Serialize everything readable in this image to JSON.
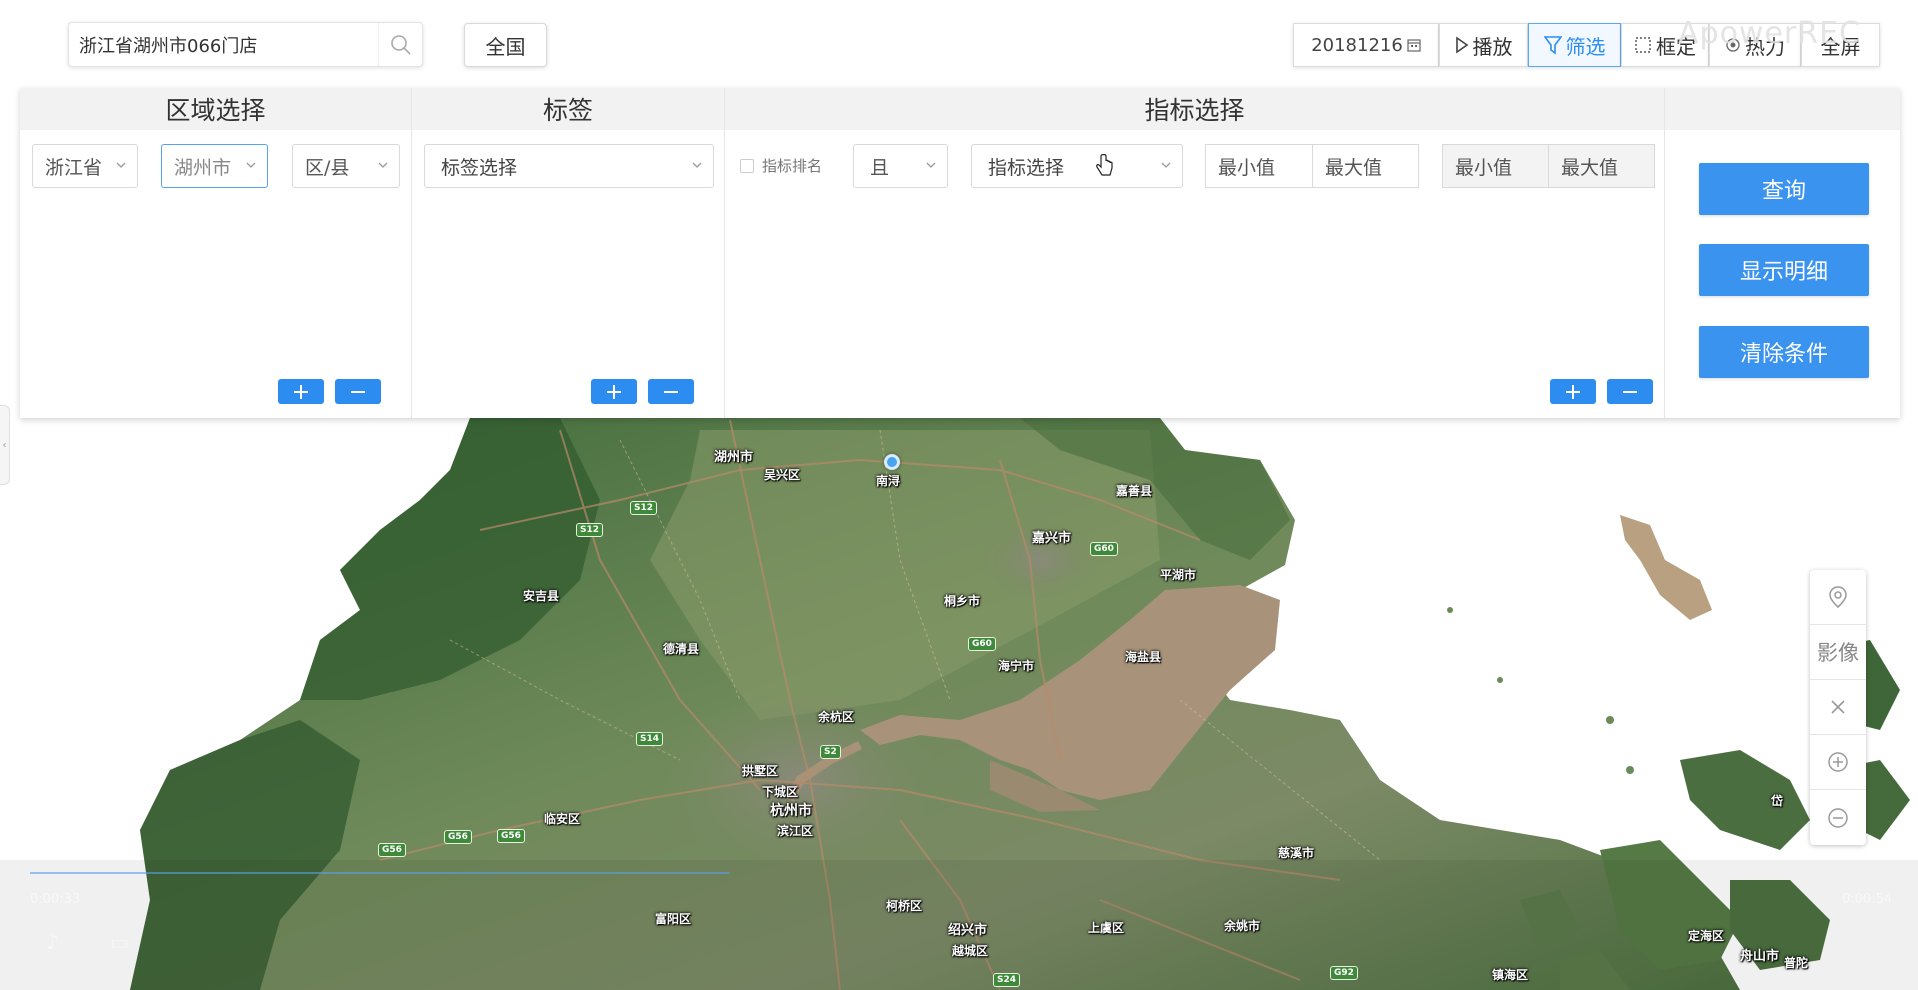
{
  "search": {
    "value": "浙江省湖州市066门店",
    "placeholder": ""
  },
  "nation_button": "全国",
  "toolbar": {
    "date": "20181216",
    "play": "播放",
    "filter": "筛选",
    "box_select": "框定",
    "heat": "热力",
    "fullscreen": "全屏"
  },
  "watermark": "ApowerREC",
  "panel": {
    "region": {
      "title": "区域选择",
      "province": "浙江省",
      "city": "湖州市",
      "district": "区/县"
    },
    "tags": {
      "title": "标签",
      "select": "标签选择"
    },
    "metrics": {
      "title": "指标选择",
      "rank_checkbox": "指标排名",
      "logic": "且",
      "metric_select": "指标选择",
      "min1": "最小值",
      "max1": "最大值",
      "min2": "最小值",
      "max2": "最大值"
    },
    "actions": {
      "query": "查询",
      "show_detail": "显示明细",
      "clear": "清除条件"
    }
  },
  "map_controls": {
    "imagery": "影像"
  },
  "map_labels": {
    "huzhou": "湖州市",
    "wuxing": "吴兴区",
    "nanxun": "南浔",
    "jiashan": "嘉善县",
    "jiaxing": "嘉兴市",
    "pinghu": "平湖市",
    "tongxiang": "桐乡市",
    "anji": "安吉县",
    "deqing": "德清县",
    "haining": "海宁市",
    "haiyan": "海盐县",
    "yuhang": "余杭区",
    "gongshu": "拱墅区",
    "xiacheng": "下城区",
    "hangzhou": "杭州市",
    "binjiang": "滨江区",
    "linan": "临安区",
    "fuyang": "富阳区",
    "keqiao": "柯桥区",
    "shaoxing": "绍兴市",
    "yuecheng": "越城区",
    "shangyu": "上虞区",
    "yuyao": "余姚市",
    "cixi": "慈溪市",
    "zhenhai": "镇海区",
    "dinghai": "定海区",
    "zhoushan": "舟山市",
    "putuo": "普陀",
    "dai": "岱"
  },
  "highway_badges": [
    "S12",
    "S12",
    "G60",
    "G60",
    "S14",
    "S2",
    "G56",
    "G56",
    "G56",
    "G92",
    "S24"
  ],
  "video": {
    "current": "0:00:33",
    "total": "0:00:54"
  },
  "colors": {
    "accent": "#2d8cf0",
    "button": "#3a93ef"
  }
}
